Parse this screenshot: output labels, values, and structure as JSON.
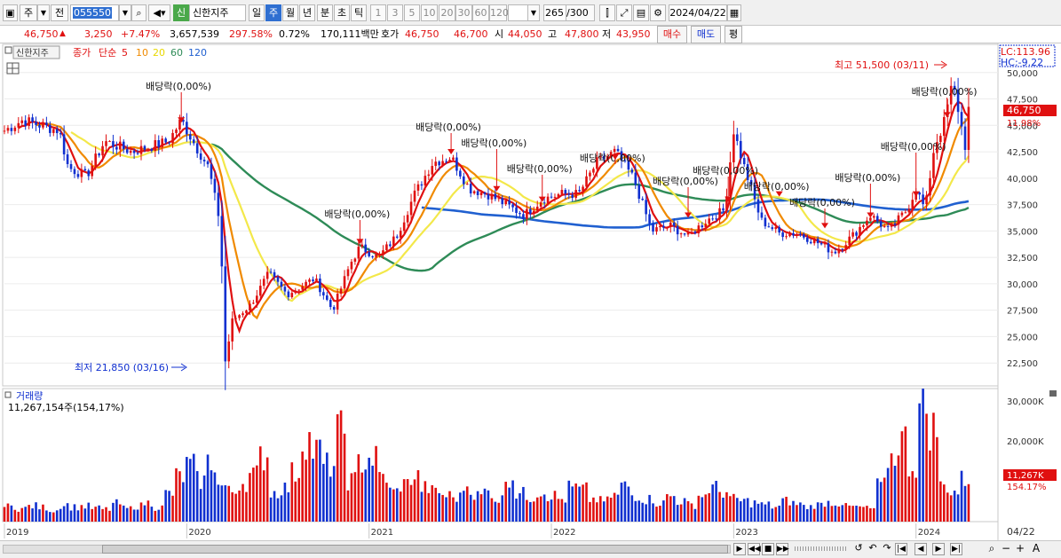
{
  "toolbar": {
    "market_label": "주",
    "prev_label": "전",
    "code": "055550",
    "stock_badge": "신",
    "stock_name": "신한지주",
    "periods": [
      "일",
      "주",
      "월",
      "년",
      "분",
      "초",
      "틱"
    ],
    "selected_period": "주",
    "intervals": [
      "1",
      "3",
      "5",
      "10",
      "20",
      "30",
      "60",
      "120"
    ],
    "count": "265",
    "count_total": "/300",
    "date": "2024/04/22"
  },
  "quote": {
    "price": "46,750",
    "change": "3,250",
    "change_pct": "+7.47%",
    "volume": "3,657,539",
    "vol_ratio": "297.58%",
    "turnover": "0.72%",
    "amount": "170,111백만",
    "bid_ask_label": "호가",
    "ask": "46,750",
    "bid": "46,700",
    "open_label": "시",
    "open": "44,050",
    "high_label": "고",
    "high": "47,800",
    "low_label": "저",
    "low": "43,950",
    "buy_label": "매수",
    "sell_label": "매도",
    "eval_label": "평"
  },
  "legend": {
    "name": "신한지주",
    "price_label": "종가",
    "ma_label": "단순",
    "ma_periods": [
      "5",
      "10",
      "20",
      "60",
      "120"
    ],
    "lc": "LC:113.96",
    "hc": "HC:-9.22",
    "last_price": "46,750",
    "last_pct": "11.98%"
  },
  "annotations": {
    "high": "최고 51,500 (03/11)",
    "low": "최저 21,850 (03/16)",
    "dividend": "배당락(0,00%)"
  },
  "volume_panel": {
    "title": "거래량",
    "value": "11,267,154주(154,17%)",
    "last_k": "11,267K",
    "last_pct": "154.17%",
    "ticks": [
      "30,000K",
      "20,000K"
    ]
  },
  "x_axis": {
    "years": [
      "2019",
      "2020",
      "2021",
      "2022",
      "2023",
      "2024"
    ],
    "current": "04/22"
  },
  "chart_data": {
    "type": "candlestick",
    "y_ticks": [
      50000,
      47500,
      45000,
      42500,
      40000,
      37500,
      35000,
      32500,
      30000,
      27500,
      25000,
      22500
    ],
    "ylim": [
      20500,
      52500
    ],
    "x_range": [
      "2019-01",
      "2024-04"
    ],
    "high_value": 51500,
    "low_value": 21850,
    "close_path": [
      [
        2019.0,
        44500
      ],
      [
        2019.1,
        45500
      ],
      [
        2019.2,
        45000
      ],
      [
        2019.3,
        44500
      ],
      [
        2019.35,
        41000
      ],
      [
        2019.45,
        40200
      ],
      [
        2019.55,
        43500
      ],
      [
        2019.7,
        42500
      ],
      [
        2019.8,
        43000
      ],
      [
        2019.9,
        43500
      ],
      [
        2019.97,
        45500
      ],
      [
        2020.05,
        43000
      ],
      [
        2020.12,
        41000
      ],
      [
        2020.18,
        36000
      ],
      [
        2020.2,
        29000
      ],
      [
        2020.21,
        22500
      ],
      [
        2020.25,
        26500
      ],
      [
        2020.35,
        28000
      ],
      [
        2020.45,
        31000
      ],
      [
        2020.55,
        29000
      ],
      [
        2020.7,
        30500
      ],
      [
        2020.8,
        27500
      ],
      [
        2020.9,
        32000
      ],
      [
        2020.95,
        33500
      ],
      [
        2021.05,
        32500
      ],
      [
        2021.15,
        34500
      ],
      [
        2021.25,
        38500
      ],
      [
        2021.35,
        41500
      ],
      [
        2021.45,
        42000
      ],
      [
        2021.55,
        39000
      ],
      [
        2021.65,
        38500
      ],
      [
        2021.75,
        37500
      ],
      [
        2021.85,
        36500
      ],
      [
        2021.95,
        38000
      ],
      [
        2022.05,
        38500
      ],
      [
        2022.15,
        38500
      ],
      [
        2022.25,
        41500
      ],
      [
        2022.35,
        42500
      ],
      [
        2022.45,
        40000
      ],
      [
        2022.55,
        35000
      ],
      [
        2022.65,
        35500
      ],
      [
        2022.75,
        34500
      ],
      [
        2022.85,
        36000
      ],
      [
        2022.95,
        37000
      ],
      [
        2023.0,
        44500
      ],
      [
        2023.05,
        41500
      ],
      [
        2023.15,
        36000
      ],
      [
        2023.25,
        34800
      ],
      [
        2023.35,
        34800
      ],
      [
        2023.45,
        34000
      ],
      [
        2023.55,
        33000
      ],
      [
        2023.65,
        34500
      ],
      [
        2023.75,
        36500
      ],
      [
        2023.85,
        35000
      ],
      [
        2023.95,
        37000
      ],
      [
        2024.0,
        39000
      ],
      [
        2024.05,
        37000
      ],
      [
        2024.1,
        43000
      ],
      [
        2024.15,
        45000
      ],
      [
        2024.2,
        49000
      ],
      [
        2024.22,
        47500
      ],
      [
        2024.27,
        43000
      ],
      [
        2024.3,
        46750
      ]
    ],
    "volume_k": [
      4000,
      3500,
      4200,
      3800,
      3000,
      4500,
      3900,
      4100,
      3600,
      3300,
      4800,
      3500,
      4200,
      5000,
      3800,
      7500,
      12000,
      15000,
      11000,
      16000,
      9500,
      8000,
      10500,
      12500,
      17500,
      7800,
      9000,
      13000,
      22000,
      19000,
      15000,
      24000,
      11000,
      16000,
      17000,
      12000,
      8000,
      10000,
      12000,
      9000,
      8000,
      7000,
      6500,
      9500,
      7000,
      8000,
      6000,
      12000,
      7500,
      6500,
      8000,
      7000,
      6000,
      9000,
      8500,
      6000,
      5500,
      7000,
      9500,
      7000,
      6000,
      5000,
      6800,
      5500,
      4500,
      7000,
      9000,
      8000,
      6000,
      5500,
      5000,
      4500,
      4000,
      5500,
      4800,
      4000,
      4500,
      5200,
      5000,
      4000,
      3800,
      3500,
      9500,
      17000,
      22000,
      15000,
      30000,
      25000,
      9500,
      8000,
      11267
    ]
  }
}
